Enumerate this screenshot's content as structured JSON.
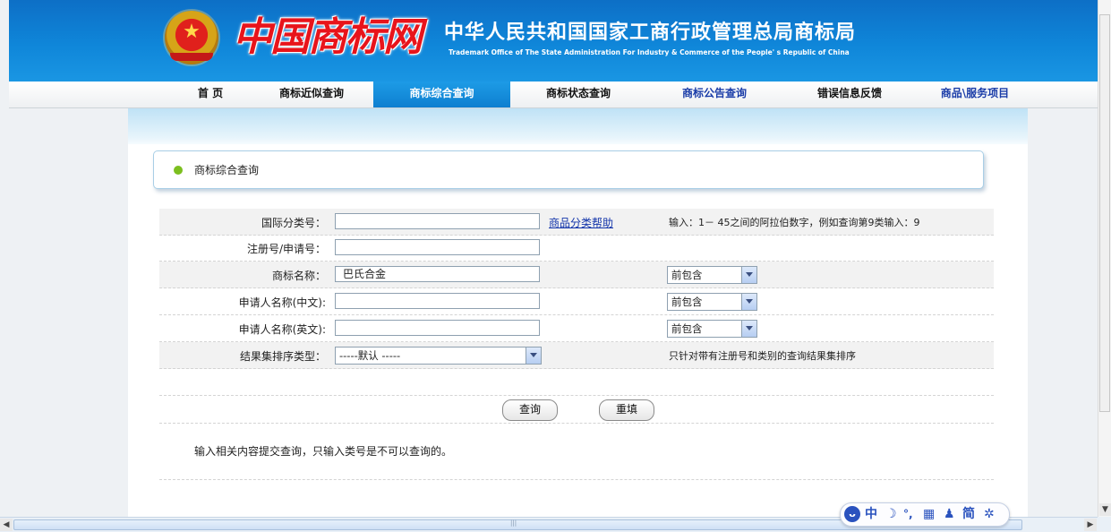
{
  "header": {
    "logo_text": "中国商标网",
    "title_cn": "中华人民共和国国家工商行政管理总局商标局",
    "title_en": "Trademark Office of The State Administration For Industry & Commerce of the People' s Republic of China"
  },
  "nav": {
    "items": [
      {
        "label": "首  页"
      },
      {
        "label": "商标近似查询"
      },
      {
        "label": "商标综合查询"
      },
      {
        "label": "商标状态查询"
      },
      {
        "label": "商标公告查询"
      },
      {
        "label": "错误信息反馈"
      },
      {
        "label": "商品\\服务项目"
      }
    ],
    "active_index": 2
  },
  "panel": {
    "title": "商标综合查询"
  },
  "form": {
    "intl_class": {
      "label": "国际分类号：",
      "value": "",
      "help_link": "商品分类帮助",
      "hint": "输入：1－ 45之间的阿拉伯数字，例如查询第9类输入：9"
    },
    "reg_no": {
      "label": "注册号/申请号：",
      "value": ""
    },
    "tm_name": {
      "label": "商标名称：",
      "value": "巴氏合金",
      "match": "前包含"
    },
    "applicant_cn": {
      "label": "申请人名称(中文):",
      "value": "",
      "match": "前包含"
    },
    "applicant_en": {
      "label": "申请人名称(英文):",
      "value": "",
      "match": "前包含"
    },
    "sort_type": {
      "label": "结果集排序类型：",
      "value": "-----默认 -----",
      "hint": "只针对带有注册号和类别的查询结果集排序"
    }
  },
  "buttons": {
    "query": "查询",
    "reset": "重填"
  },
  "note": "输入相关内容提交查询，只输入类号是不可以查询的。",
  "ime": {
    "lang": "中",
    "mode": "简"
  },
  "colors": {
    "header_blue": "#0f86d9",
    "active_tab": "#1d9be6",
    "link": "#1234aa",
    "dot_green": "#7cbf1f"
  }
}
